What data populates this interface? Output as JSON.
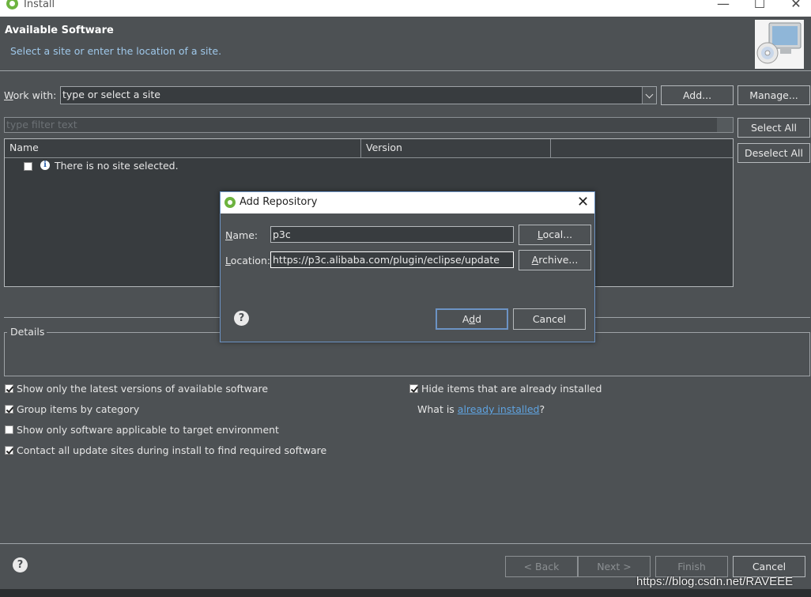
{
  "window": {
    "title": "Install",
    "controls": [
      "minimize-icon",
      "maximize-icon",
      "close-icon"
    ]
  },
  "header": {
    "title": "Available Software",
    "subtitle": "Select a site or enter the location of a site."
  },
  "work_with": {
    "label_pre": "",
    "label_mn": "W",
    "label_post": "ork with:",
    "value": "type or select a site",
    "add_button": "Add...",
    "manage_button": "Manage..."
  },
  "filter": {
    "placeholder": "type filter text"
  },
  "side_buttons": {
    "select_all": "Select All",
    "deselect_all": "Deselect All"
  },
  "table": {
    "columns": [
      "Name",
      "Version"
    ],
    "rows": [
      {
        "name": "There is no site selected.",
        "checked": false
      }
    ]
  },
  "details": {
    "label": "Details"
  },
  "options_left": [
    {
      "label": "Show only the latest versions of available software",
      "checked": true
    },
    {
      "label": "Group items by category",
      "checked": true
    },
    {
      "label": "Show only software applicable to target environment",
      "checked": false
    },
    {
      "label": "Contact all update sites during install to find required software",
      "checked": true
    }
  ],
  "options_right": {
    "hide_installed": {
      "label": "Hide items that are already installed",
      "checked": true
    },
    "what_is_pre": "What is ",
    "what_is_link": "already installed",
    "what_is_post": "?"
  },
  "footer": {
    "back": "< Back",
    "next": "Next >",
    "finish": "Finish",
    "cancel": "Cancel"
  },
  "dialog": {
    "title": "Add Repository",
    "name_label": "Name:",
    "name_value": "p3c",
    "location_label": "Location:",
    "location_value": "https://p3c.alibaba.com/plugin/eclipse/update",
    "local_button": "Local...",
    "archive_button": "Archive...",
    "add_button": "Add",
    "cancel_button": "Cancel"
  },
  "watermark": "https://blog.csdn.net/RAVEEE",
  "colors": {
    "background": "#4d5154",
    "field": "#383c3f",
    "link": "#5fa3e0",
    "subtitle": "#9fc8ea",
    "dialog_border": "#6c93c4"
  }
}
